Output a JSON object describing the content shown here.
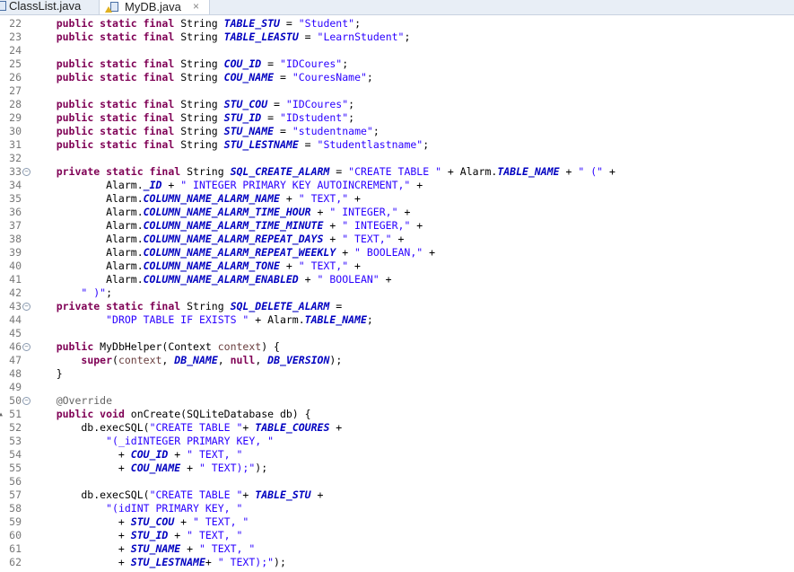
{
  "tabs": [
    {
      "label": "ClassList.java"
    },
    {
      "label": "MyDB.java",
      "close": "×"
    }
  ],
  "colors": {
    "keyword": "#7f0055",
    "field": "#0000c0",
    "string": "#2a00ff",
    "annotation": "#646464",
    "local": "#6a3e3e"
  },
  "code": {
    "lines": [
      {
        "n": "22",
        "t": [
          [
            "p",
            "    "
          ],
          [
            "k",
            "public static final "
          ],
          [
            "p",
            "String "
          ],
          [
            "f",
            "TABLE_STU"
          ],
          [
            "p",
            " = "
          ],
          [
            "s",
            "\"Student\""
          ],
          [
            "p",
            ";"
          ]
        ]
      },
      {
        "n": "23",
        "t": [
          [
            "p",
            "    "
          ],
          [
            "k",
            "public static final "
          ],
          [
            "p",
            "String "
          ],
          [
            "f",
            "TABLE_LEASTU"
          ],
          [
            "p",
            " = "
          ],
          [
            "s",
            "\"LearnStudent\""
          ],
          [
            "p",
            ";"
          ]
        ]
      },
      {
        "n": "24",
        "t": []
      },
      {
        "n": "25",
        "t": [
          [
            "p",
            "    "
          ],
          [
            "k",
            "public static final "
          ],
          [
            "p",
            "String "
          ],
          [
            "f",
            "COU_ID"
          ],
          [
            "p",
            " = "
          ],
          [
            "s",
            "\"IDCoures\""
          ],
          [
            "p",
            ";"
          ]
        ]
      },
      {
        "n": "26",
        "t": [
          [
            "p",
            "    "
          ],
          [
            "k",
            "public static final "
          ],
          [
            "p",
            "String "
          ],
          [
            "f",
            "COU_NAME"
          ],
          [
            "p",
            " = "
          ],
          [
            "s",
            "\"CouresName\""
          ],
          [
            "p",
            ";"
          ]
        ]
      },
      {
        "n": "27",
        "t": []
      },
      {
        "n": "28",
        "t": [
          [
            "p",
            "    "
          ],
          [
            "k",
            "public static final "
          ],
          [
            "p",
            "String "
          ],
          [
            "f",
            "STU_COU"
          ],
          [
            "p",
            " = "
          ],
          [
            "s",
            "\"IDCoures\""
          ],
          [
            "p",
            ";"
          ]
        ]
      },
      {
        "n": "29",
        "t": [
          [
            "p",
            "    "
          ],
          [
            "k",
            "public static final "
          ],
          [
            "p",
            "String "
          ],
          [
            "f",
            "STU_ID"
          ],
          [
            "p",
            " = "
          ],
          [
            "s",
            "\"IDstudent\""
          ],
          [
            "p",
            ";"
          ]
        ]
      },
      {
        "n": "30",
        "t": [
          [
            "p",
            "    "
          ],
          [
            "k",
            "public static final "
          ],
          [
            "p",
            "String "
          ],
          [
            "f",
            "STU_NAME"
          ],
          [
            "p",
            " = "
          ],
          [
            "s",
            "\"studentname\""
          ],
          [
            "p",
            ";"
          ]
        ]
      },
      {
        "n": "31",
        "t": [
          [
            "p",
            "    "
          ],
          [
            "k",
            "public static final "
          ],
          [
            "p",
            "String "
          ],
          [
            "f",
            "STU_LESTNAME"
          ],
          [
            "p",
            " = "
          ],
          [
            "s",
            "\"Studentlastname\""
          ],
          [
            "p",
            ";"
          ]
        ]
      },
      {
        "n": "32",
        "t": []
      },
      {
        "n": "33",
        "fold": true,
        "t": [
          [
            "p",
            "    "
          ],
          [
            "k",
            "private static final "
          ],
          [
            "p",
            "String "
          ],
          [
            "f",
            "SQL_CREATE_ALARM"
          ],
          [
            "p",
            " = "
          ],
          [
            "s",
            "\"CREATE TABLE \""
          ],
          [
            "p",
            " + Alarm."
          ],
          [
            "f",
            "TABLE_NAME"
          ],
          [
            "p",
            " + "
          ],
          [
            "s",
            "\" (\""
          ],
          [
            "p",
            " +"
          ]
        ]
      },
      {
        "n": "34",
        "t": [
          [
            "p",
            "            Alarm."
          ],
          [
            "f",
            "_ID"
          ],
          [
            "p",
            " + "
          ],
          [
            "s",
            "\" INTEGER PRIMARY KEY AUTOINCREMENT,\""
          ],
          [
            "p",
            " +"
          ]
        ]
      },
      {
        "n": "35",
        "t": [
          [
            "p",
            "            Alarm."
          ],
          [
            "f",
            "COLUMN_NAME_ALARM_NAME"
          ],
          [
            "p",
            " + "
          ],
          [
            "s",
            "\" TEXT,\""
          ],
          [
            "p",
            " +"
          ]
        ]
      },
      {
        "n": "36",
        "t": [
          [
            "p",
            "            Alarm."
          ],
          [
            "f",
            "COLUMN_NAME_ALARM_TIME_HOUR"
          ],
          [
            "p",
            " + "
          ],
          [
            "s",
            "\" INTEGER,\""
          ],
          [
            "p",
            " +"
          ]
        ]
      },
      {
        "n": "37",
        "t": [
          [
            "p",
            "            Alarm."
          ],
          [
            "f",
            "COLUMN_NAME_ALARM_TIME_MINUTE"
          ],
          [
            "p",
            " + "
          ],
          [
            "s",
            "\" INTEGER,\""
          ],
          [
            "p",
            " +"
          ]
        ]
      },
      {
        "n": "38",
        "t": [
          [
            "p",
            "            Alarm."
          ],
          [
            "f",
            "COLUMN_NAME_ALARM_REPEAT_DAYS"
          ],
          [
            "p",
            " + "
          ],
          [
            "s",
            "\" TEXT,\""
          ],
          [
            "p",
            " +"
          ]
        ]
      },
      {
        "n": "39",
        "t": [
          [
            "p",
            "            Alarm."
          ],
          [
            "f",
            "COLUMN_NAME_ALARM_REPEAT_WEEKLY"
          ],
          [
            "p",
            " + "
          ],
          [
            "s",
            "\" BOOLEAN,\""
          ],
          [
            "p",
            " +"
          ]
        ]
      },
      {
        "n": "40",
        "t": [
          [
            "p",
            "            Alarm."
          ],
          [
            "f",
            "COLUMN_NAME_ALARM_TONE"
          ],
          [
            "p",
            " + "
          ],
          [
            "s",
            "\" TEXT,\""
          ],
          [
            "p",
            " +"
          ]
        ]
      },
      {
        "n": "41",
        "t": [
          [
            "p",
            "            Alarm."
          ],
          [
            "f",
            "COLUMN_NAME_ALARM_ENABLED"
          ],
          [
            "p",
            " + "
          ],
          [
            "s",
            "\" BOOLEAN\""
          ],
          [
            "p",
            " +"
          ]
        ]
      },
      {
        "n": "42",
        "t": [
          [
            "p",
            "        "
          ],
          [
            "s",
            "\" )\""
          ],
          [
            "p",
            ";"
          ]
        ]
      },
      {
        "n": "43",
        "fold": true,
        "t": [
          [
            "p",
            "    "
          ],
          [
            "k",
            "private static final "
          ],
          [
            "p",
            "String "
          ],
          [
            "f",
            "SQL_DELETE_ALARM"
          ],
          [
            "p",
            " ="
          ]
        ]
      },
      {
        "n": "44",
        "t": [
          [
            "p",
            "            "
          ],
          [
            "s",
            "\"DROP TABLE IF EXISTS \""
          ],
          [
            "p",
            " + Alarm."
          ],
          [
            "f",
            "TABLE_NAME"
          ],
          [
            "p",
            ";"
          ]
        ]
      },
      {
        "n": "45",
        "t": []
      },
      {
        "n": "46",
        "fold": true,
        "t": [
          [
            "p",
            "    "
          ],
          [
            "k",
            "public "
          ],
          [
            "p",
            "MyDbHelper(Context "
          ],
          [
            "v",
            "context"
          ],
          [
            "p",
            ") {"
          ]
        ]
      },
      {
        "n": "47",
        "t": [
          [
            "p",
            "        "
          ],
          [
            "k",
            "super"
          ],
          [
            "p",
            "("
          ],
          [
            "v",
            "context"
          ],
          [
            "p",
            ", "
          ],
          [
            "f",
            "DB_NAME"
          ],
          [
            "p",
            ", "
          ],
          [
            "k",
            "null"
          ],
          [
            "p",
            ", "
          ],
          [
            "f",
            "DB_VERSION"
          ],
          [
            "p",
            ");"
          ]
        ]
      },
      {
        "n": "48",
        "t": [
          [
            "p",
            "    }"
          ]
        ]
      },
      {
        "n": "49",
        "t": []
      },
      {
        "n": "50",
        "fold": true,
        "t": [
          [
            "p",
            "    "
          ],
          [
            "a",
            "@Override"
          ]
        ]
      },
      {
        "n": "51",
        "mark": true,
        "t": [
          [
            "p",
            "    "
          ],
          [
            "k",
            "public void "
          ],
          [
            "p",
            "onCreate(SQLiteDatabase db) {"
          ]
        ]
      },
      {
        "n": "52",
        "t": [
          [
            "p",
            "        db.execSQL("
          ],
          [
            "s",
            "\"CREATE TABLE \""
          ],
          [
            "p",
            "+ "
          ],
          [
            "f",
            "TABLE_COURES"
          ],
          [
            "p",
            " +"
          ]
        ]
      },
      {
        "n": "53",
        "t": [
          [
            "p",
            "            "
          ],
          [
            "s",
            "\"(_idINTEGER PRIMARY KEY, \""
          ]
        ]
      },
      {
        "n": "54",
        "t": [
          [
            "p",
            "              + "
          ],
          [
            "f",
            "COU_ID"
          ],
          [
            "p",
            " + "
          ],
          [
            "s",
            "\" TEXT, \""
          ]
        ]
      },
      {
        "n": "55",
        "t": [
          [
            "p",
            "              + "
          ],
          [
            "f",
            "COU_NAME"
          ],
          [
            "p",
            " + "
          ],
          [
            "s",
            "\" TEXT);\""
          ],
          [
            "p",
            ");"
          ]
        ]
      },
      {
        "n": "56",
        "t": []
      },
      {
        "n": "57",
        "t": [
          [
            "p",
            "        db.execSQL("
          ],
          [
            "s",
            "\"CREATE TABLE \""
          ],
          [
            "p",
            "+ "
          ],
          [
            "f",
            "TABLE_STU"
          ],
          [
            "p",
            " +"
          ]
        ]
      },
      {
        "n": "58",
        "t": [
          [
            "p",
            "            "
          ],
          [
            "s",
            "\"(idINT PRIMARY KEY, \""
          ]
        ]
      },
      {
        "n": "59",
        "t": [
          [
            "p",
            "              + "
          ],
          [
            "f",
            "STU_COU"
          ],
          [
            "p",
            " + "
          ],
          [
            "s",
            "\" TEXT, \""
          ]
        ]
      },
      {
        "n": "60",
        "t": [
          [
            "p",
            "              + "
          ],
          [
            "f",
            "STU_ID"
          ],
          [
            "p",
            " + "
          ],
          [
            "s",
            "\" TEXT, \""
          ]
        ]
      },
      {
        "n": "61",
        "t": [
          [
            "p",
            "              + "
          ],
          [
            "f",
            "STU_NAME"
          ],
          [
            "p",
            " + "
          ],
          [
            "s",
            "\" TEXT, \""
          ]
        ]
      },
      {
        "n": "62",
        "t": [
          [
            "p",
            "              + "
          ],
          [
            "f",
            "STU_LESTNAME"
          ],
          [
            "p",
            "+ "
          ],
          [
            "s",
            "\" TEXT);\""
          ],
          [
            "p",
            ");"
          ]
        ]
      }
    ]
  }
}
